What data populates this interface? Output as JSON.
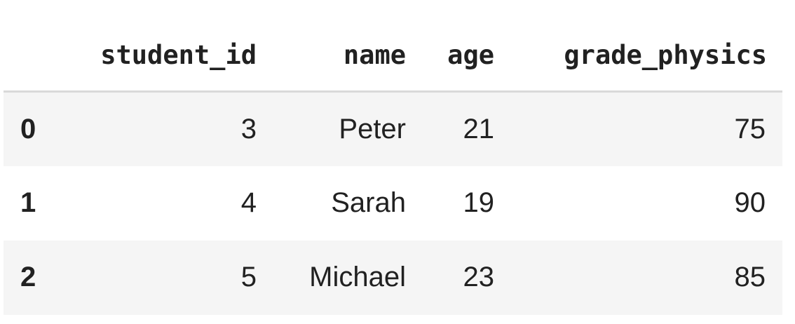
{
  "table": {
    "index_header": "",
    "columns": [
      "student_id",
      "name",
      "age",
      "grade_physics"
    ],
    "rows": [
      {
        "index": "0",
        "cells": [
          "3",
          "Peter",
          "21",
          "75"
        ]
      },
      {
        "index": "1",
        "cells": [
          "4",
          "Sarah",
          "19",
          "90"
        ]
      },
      {
        "index": "2",
        "cells": [
          "5",
          "Michael",
          "23",
          "85"
        ]
      }
    ]
  }
}
